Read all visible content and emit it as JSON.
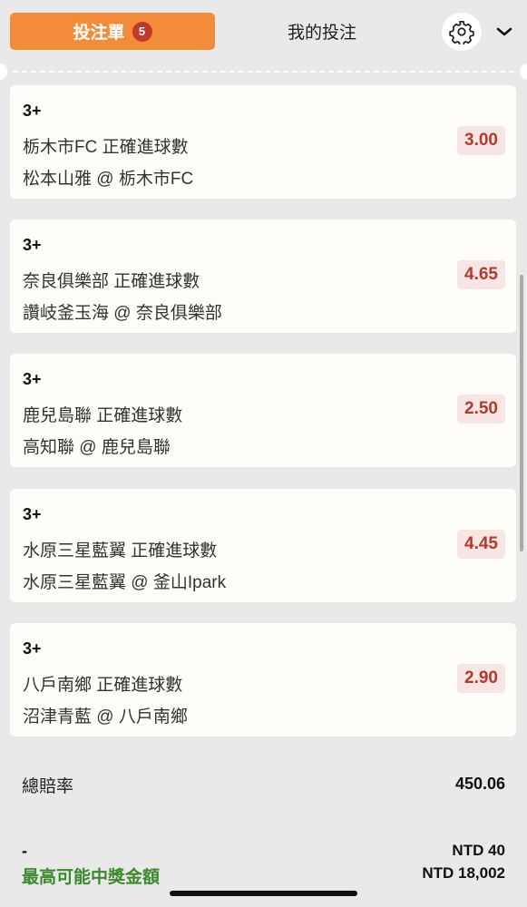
{
  "header": {
    "tab_betslip": "投注單",
    "betslip_count": "5",
    "tab_mybets": "我的投注",
    "settings_icon": "gear-icon",
    "collapse_icon": "chevron-down-icon"
  },
  "colors": {
    "accent": "#f28c38",
    "badge": "#c0392b",
    "odds_text": "#b23a2f",
    "odds_bg": "#f7e6e3",
    "win_label": "#3b8a2c"
  },
  "bets": [
    {
      "selection": "3+",
      "market": "栃木市FC 正確進球數",
      "match": "松本山雅 @ 栃木市FC",
      "odds": "3.00"
    },
    {
      "selection": "3+",
      "market": "奈良俱樂部 正確進球數",
      "match": "讚岐釜玉海 @ 奈良俱樂部",
      "odds": "4.65"
    },
    {
      "selection": "3+",
      "market": "鹿兒島聯 正確進球數",
      "match": "高知聯 @ 鹿兒島聯",
      "odds": "2.50"
    },
    {
      "selection": "3+",
      "market": "水原三星藍翼 正確進球數",
      "match": "水原三星藍翼 @ 釜山Ipark",
      "odds": "4.45"
    },
    {
      "selection": "3+",
      "market": "八戶南鄉 正確進球數",
      "match": "沼津青藍 @ 八戶南鄉",
      "odds": "2.90"
    }
  ],
  "summary": {
    "total_odds_label": "總賠率",
    "total_odds_value": "450.06",
    "stake_label": "-",
    "stake_value": "NTD 40",
    "max_win_label": "最高可能中獎金額",
    "max_win_value": "NTD 18,002"
  }
}
